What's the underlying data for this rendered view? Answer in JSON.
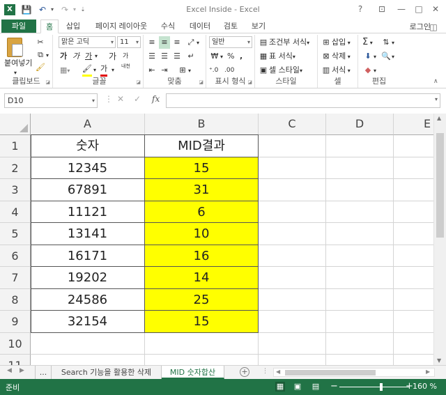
{
  "app": {
    "title": "Excel Inside - Excel",
    "logo_letter": "X",
    "login": "로그인",
    "window_icons": [
      "help-icon",
      "ribbon-display-icon",
      "minimize-icon",
      "restore-icon",
      "close-icon"
    ],
    "accent": "#217346"
  },
  "ribbon": {
    "file_tab": "파일",
    "tabs": [
      "홈",
      "삽입",
      "페이지 레이아웃",
      "수식",
      "데이터",
      "검토",
      "보기"
    ],
    "active_tab": "홈",
    "clipboard": {
      "label": "클립보드",
      "paste": "붙여넣기"
    },
    "font": {
      "label": "글꼴",
      "font_name": "맑은 고딕",
      "font_size": "11",
      "bold": "가",
      "italic": "가",
      "underline": "가",
      "grow": "가",
      "shrink": "가",
      "fill_color_glyph": "🖌",
      "font_color_glyph": "가",
      "phonetic_glyph": "내천"
    },
    "alignment": {
      "label": "맞춤"
    },
    "number": {
      "label": "표시 형식",
      "format": "일반",
      "percent": "%",
      "comma": ","
    },
    "styles": {
      "label": "스타일",
      "conditional": "조건부 서식",
      "table": "표 서식",
      "cell_styles": "셀 스타일"
    },
    "cells": {
      "label": "셀",
      "insert": "삽입",
      "delete": "삭제",
      "format": "서식"
    },
    "editing": {
      "label": "편집",
      "sum": "Σ"
    }
  },
  "formula_bar": {
    "name_box": "D10",
    "fx": "fx",
    "cancel": "✕",
    "enter": "✓",
    "formula": ""
  },
  "sheet": {
    "columns": [
      "A",
      "B",
      "C",
      "D",
      "E"
    ],
    "rows": [
      "1",
      "2",
      "3",
      "4",
      "5",
      "6",
      "7",
      "8",
      "9",
      "10",
      "11"
    ],
    "header": [
      "숫자",
      "MID결과"
    ],
    "data": [
      [
        "12345",
        "15"
      ],
      [
        "67891",
        "31"
      ],
      [
        "11121",
        "6"
      ],
      [
        "13141",
        "10"
      ],
      [
        "16171",
        "16"
      ],
      [
        "19202",
        "14"
      ],
      [
        "24586",
        "25"
      ],
      [
        "32154",
        "15"
      ]
    ],
    "highlight_color": "#ffff00"
  },
  "sheet_tabs": {
    "ellipsis": "...",
    "tabs": [
      "Search 기능을 활용한 삭제",
      "MID 숫자합산"
    ],
    "active": "MID 숫자합산",
    "add": "+"
  },
  "status": {
    "text": "준비",
    "zoom": "160 %",
    "zoom_minus": "−",
    "zoom_plus": "+"
  }
}
